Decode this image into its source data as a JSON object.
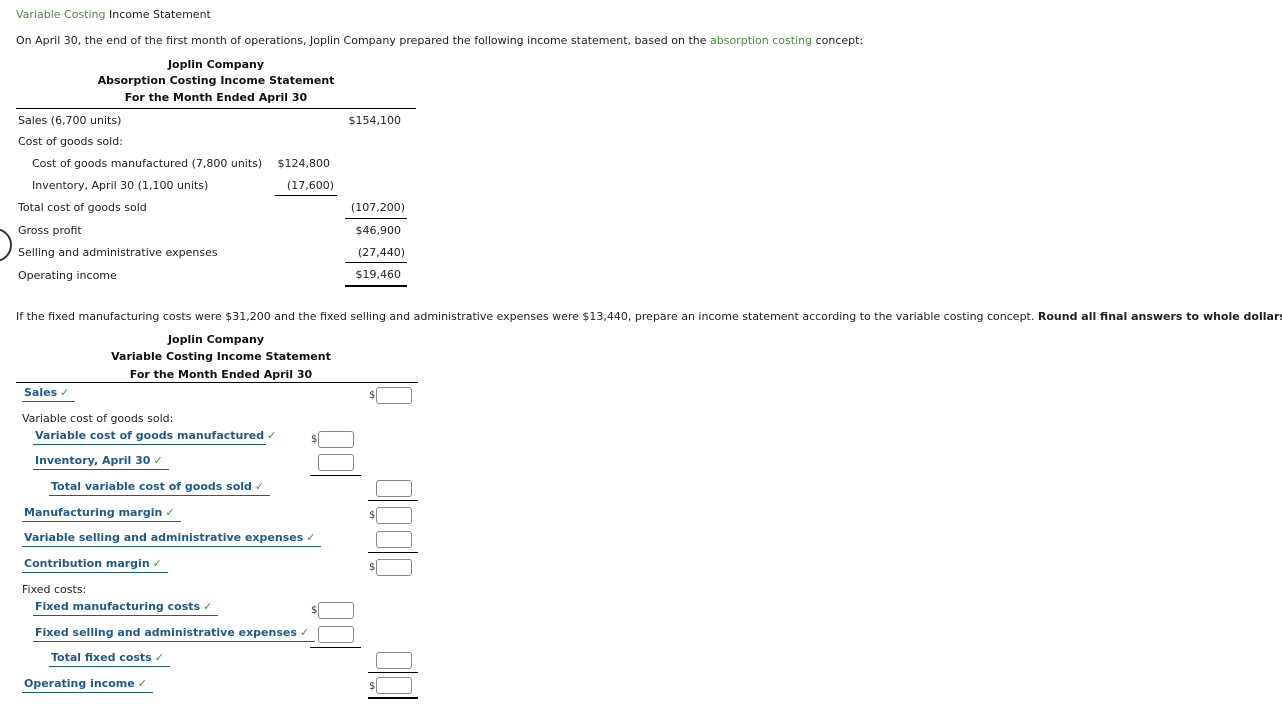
{
  "title": {
    "green": "Variable Costing",
    "rest": " Income Statement"
  },
  "intro": {
    "before": "On April 30, the end of the first month of operations, Joplin Company prepared the following income statement, based on the ",
    "link": "absorption costing",
    "after": " concept:"
  },
  "absorption": {
    "company": "Joplin Company",
    "statement": "Absorption Costing Income Statement",
    "period": "For the Month Ended April 30",
    "rows": [
      {
        "label": "Sales (6,700 units)",
        "col2": "$154,100"
      },
      {
        "label": "Cost of goods sold:"
      },
      {
        "label": "Cost of goods manufactured (7,800 units)",
        "col1": "$124,800"
      },
      {
        "label": "Inventory, April 30 (1,100 units)",
        "col1": "(17,600)"
      },
      {
        "label": "Total cost of goods sold",
        "col2": "(107,200)"
      },
      {
        "label": "Gross profit",
        "col2": "$46,900"
      },
      {
        "label": "Selling and administrative expenses",
        "col2": "(27,440)"
      },
      {
        "label": "Operating income",
        "col2": "$19,460"
      }
    ]
  },
  "instructions": {
    "text": "If the fixed manufacturing costs were $31,200 and the fixed selling and administrative expenses were $13,440, prepare an income statement according to the variable costing concept. ",
    "bold": "Round all final answers to whole dollars."
  },
  "variable": {
    "company": "Joplin Company",
    "statement": "Variable Costing Income Statement",
    "period": "For the Month Ended April 30",
    "check": "✓",
    "currency": "$",
    "sales": "Sales",
    "vcogs_header": "Variable cost of goods sold:",
    "vcgm": "Variable cost of goods manufactured",
    "inventory": "Inventory, April 30",
    "total_vcogs": "Total variable cost of goods sold",
    "mfg_margin": "Manufacturing margin",
    "var_sa": "Variable selling and administrative expenses",
    "contribution": "Contribution margin",
    "fixed_header": "Fixed costs:",
    "fixed_mfg": "Fixed manufacturing costs",
    "fixed_sa": "Fixed selling and administrative expenses",
    "total_fixed": "Total fixed costs",
    "operating_income": "Operating income",
    "inputs": {
      "sales": "",
      "vcgm": "",
      "inventory": "",
      "total_vcogs": "",
      "mfg_margin": "",
      "var_sa": "",
      "contribution": "",
      "fixed_mfg": "",
      "fixed_sa": "",
      "total_fixed": "",
      "operating_income": ""
    }
  }
}
